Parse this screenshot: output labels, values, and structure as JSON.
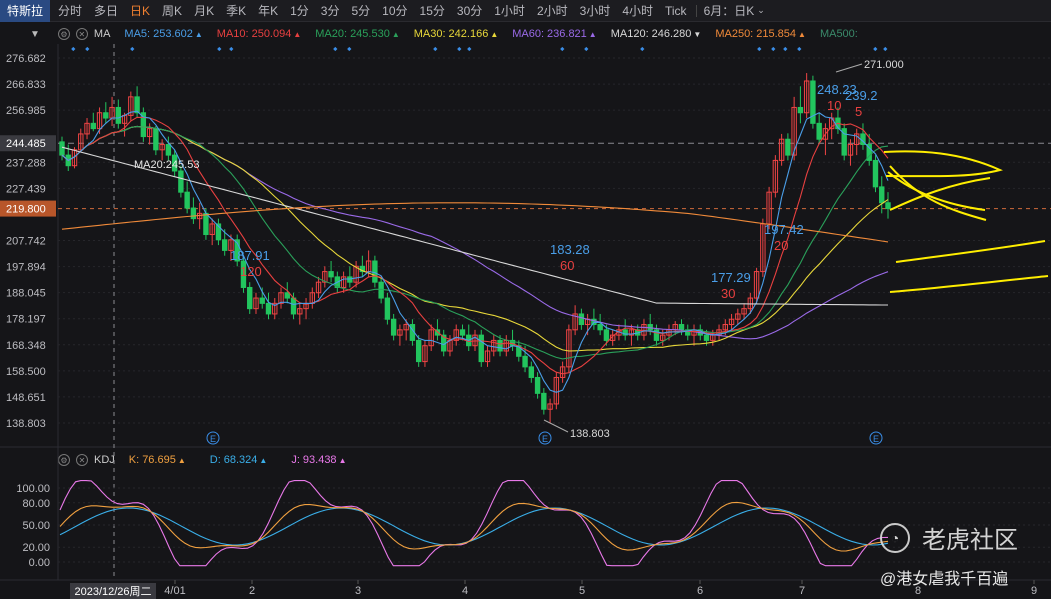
{
  "topbar": {
    "stock": "特斯拉",
    "tabs": [
      "分时",
      "多日",
      "日K",
      "周K",
      "月K",
      "季K",
      "年K",
      "1分",
      "3分",
      "5分",
      "10分",
      "15分",
      "30分",
      "1小时",
      "2小时",
      "3小时",
      "4小时",
      "Tick"
    ],
    "active_tab": "日K",
    "period_select": "6月：日K"
  },
  "ma_bar": {
    "label": "MA",
    "items": [
      {
        "name": "MA5:",
        "value": "253.602",
        "color": "#4a9ee8",
        "trend": "up"
      },
      {
        "name": "MA10:",
        "value": "250.094",
        "color": "#e84040",
        "trend": "up"
      },
      {
        "name": "MA20:",
        "value": "245.530",
        "color": "#2aa05a",
        "trend": "up"
      },
      {
        "name": "MA30:",
        "value": "242.166",
        "color": "#e8d83a",
        "trend": "up"
      },
      {
        "name": "MA60:",
        "value": "236.821",
        "color": "#9a6ae8",
        "trend": "up"
      },
      {
        "name": "MA120:",
        "value": "246.280",
        "color": "#d8d8d8",
        "trend": "down"
      },
      {
        "name": "MA250:",
        "value": "215.854",
        "color": "#f08a3a",
        "trend": "up"
      },
      {
        "name": "MA500:",
        "value": "",
        "color": "#3a8a6a",
        "trend": ""
      }
    ]
  },
  "kdj_bar": {
    "label": "KDJ",
    "items": [
      {
        "name": "K:",
        "value": "76.695",
        "color": "#f0a040",
        "trend": "up"
      },
      {
        "name": "D:",
        "value": "68.324",
        "color": "#3aaee8",
        "trend": "up"
      },
      {
        "name": "J:",
        "value": "93.438",
        "color": "#e878e8",
        "trend": "up"
      }
    ]
  },
  "price_axis": {
    "ticks": [
      "276.682",
      "266.833",
      "256.985",
      "237.288",
      "227.439",
      "207.742",
      "197.894",
      "188.045",
      "178.197",
      "168.348",
      "158.500",
      "148.651",
      "138.803"
    ],
    "crosshair_label": "244.485",
    "last_price_label": "219.800"
  },
  "kdj_axis": {
    "ticks": [
      "100.00",
      "80.00",
      "50.00",
      "20.00",
      "0.00"
    ]
  },
  "x_axis": {
    "labels": [
      "4/01",
      "2",
      "3",
      "4",
      "5",
      "6",
      "7",
      "8",
      "9"
    ],
    "cursor_label": "2023/12/26周二"
  },
  "annotations": {
    "cursor_ma": "MA20:245.53",
    "high_label": "271.000",
    "low_label": "138.803",
    "peaks": [
      {
        "price": "187.91",
        "count": "120"
      },
      {
        "price": "183.28",
        "count": "60"
      },
      {
        "price": "177.29",
        "count": "30"
      },
      {
        "price": "197.42",
        "count": "20"
      },
      {
        "price": "248.23",
        "count": "10"
      },
      {
        "price": "239.2",
        "count": "5"
      }
    ],
    "earnings_marker": "E"
  },
  "watermark": {
    "brand": "老虎社区",
    "credit": "@港女虐我千百遍"
  },
  "colors": {
    "up": "#ef4444",
    "down": "#22c55e",
    "ma5": "#4a9ee8",
    "ma10": "#e84040",
    "ma20": "#2aa05a",
    "ma30": "#e8d83a",
    "ma60": "#9a6ae8",
    "ma120": "#d8d8d8",
    "ma250": "#f08a3a",
    "drawing": "#ffee00"
  },
  "chart_data": {
    "type": "candlestick",
    "ylim": [
      138.803,
      276.682
    ],
    "candles": [
      [
        245,
        247,
        238,
        240
      ],
      [
        240,
        244,
        234,
        236
      ],
      [
        236,
        243,
        235,
        242
      ],
      [
        242,
        250,
        241,
        248
      ],
      [
        248,
        254,
        246,
        252
      ],
      [
        252,
        256,
        249,
        250
      ],
      [
        250,
        258,
        248,
        256
      ],
      [
        256,
        260,
        252,
        254
      ],
      [
        254,
        262,
        251,
        258
      ],
      [
        258,
        261,
        250,
        252
      ],
      [
        252,
        256,
        247,
        255
      ],
      [
        255,
        264,
        253,
        262
      ],
      [
        262,
        266,
        254,
        256
      ],
      [
        256,
        258,
        245,
        247
      ],
      [
        247,
        252,
        244,
        250
      ],
      [
        250,
        251,
        240,
        242
      ],
      [
        242,
        246,
        238,
        244
      ],
      [
        244,
        247,
        238,
        240
      ],
      [
        240,
        242,
        232,
        234
      ],
      [
        234,
        236,
        224,
        226
      ],
      [
        226,
        230,
        218,
        220
      ],
      [
        220,
        224,
        214,
        216
      ],
      [
        216,
        222,
        212,
        218
      ],
      [
        218,
        220,
        208,
        210
      ],
      [
        210,
        216,
        206,
        214
      ],
      [
        214,
        216,
        206,
        208
      ],
      [
        208,
        212,
        202,
        204
      ],
      [
        204,
        210,
        200,
        208
      ],
      [
        208,
        210,
        198,
        200
      ],
      [
        200,
        202,
        188,
        190
      ],
      [
        190,
        192,
        180,
        182
      ],
      [
        182,
        188,
        180,
        186
      ],
      [
        186,
        190,
        182,
        184
      ],
      [
        184,
        188,
        178,
        180
      ],
      [
        180,
        186,
        178,
        184
      ],
      [
        184,
        190,
        182,
        188
      ],
      [
        188,
        192,
        184,
        186
      ],
      [
        186,
        188,
        178,
        180
      ],
      [
        180,
        184,
        176,
        182
      ],
      [
        182,
        186,
        178,
        184
      ],
      [
        184,
        190,
        182,
        188
      ],
      [
        188,
        194,
        186,
        192
      ],
      [
        192,
        198,
        190,
        196
      ],
      [
        196,
        200,
        192,
        194
      ],
      [
        194,
        196,
        188,
        190
      ],
      [
        190,
        196,
        188,
        194
      ],
      [
        194,
        198,
        190,
        192
      ],
      [
        192,
        200,
        190,
        198
      ],
      [
        198,
        202,
        194,
        196
      ],
      [
        196,
        204,
        194,
        200
      ],
      [
        200,
        202,
        190,
        192
      ],
      [
        192,
        194,
        184,
        186
      ],
      [
        186,
        188,
        176,
        178
      ],
      [
        178,
        180,
        170,
        172
      ],
      [
        172,
        176,
        168,
        174
      ],
      [
        174,
        178,
        170,
        176
      ],
      [
        176,
        178,
        168,
        170
      ],
      [
        170,
        172,
        160,
        162
      ],
      [
        162,
        170,
        160,
        168
      ],
      [
        168,
        176,
        166,
        174
      ],
      [
        174,
        178,
        170,
        172
      ],
      [
        172,
        174,
        164,
        166
      ],
      [
        166,
        172,
        164,
        170
      ],
      [
        170,
        176,
        168,
        174
      ],
      [
        174,
        176,
        170,
        172
      ],
      [
        172,
        176,
        166,
        168
      ],
      [
        168,
        174,
        166,
        172
      ],
      [
        172,
        174,
        160,
        162
      ],
      [
        162,
        168,
        160,
        166
      ],
      [
        166,
        172,
        164,
        170
      ],
      [
        170,
        172,
        164,
        166
      ],
      [
        166,
        172,
        164,
        170
      ],
      [
        170,
        174,
        166,
        168
      ],
      [
        168,
        170,
        162,
        164
      ],
      [
        164,
        168,
        158,
        160
      ],
      [
        160,
        162,
        154,
        156
      ],
      [
        156,
        158,
        148,
        150
      ],
      [
        150,
        152,
        142,
        144
      ],
      [
        144,
        148,
        138.803,
        146
      ],
      [
        146,
        158,
        144,
        156
      ],
      [
        156,
        162,
        154,
        160
      ],
      [
        160,
        176,
        158,
        174
      ],
      [
        174,
        183.28,
        172,
        180
      ],
      [
        180,
        182,
        174,
        176
      ],
      [
        176,
        180,
        172,
        178
      ],
      [
        178,
        182,
        174,
        176
      ],
      [
        176,
        180,
        172,
        174
      ],
      [
        174,
        176,
        168,
        170
      ],
      [
        170,
        174,
        168,
        172
      ],
      [
        172,
        176,
        170,
        174
      ],
      [
        174,
        178,
        170,
        172
      ],
      [
        172,
        176,
        168,
        174
      ],
      [
        174,
        176,
        170,
        172
      ],
      [
        172,
        178,
        170,
        176
      ],
      [
        176,
        180,
        172,
        174
      ],
      [
        174,
        176,
        168,
        170
      ],
      [
        170,
        174,
        168,
        172
      ],
      [
        172,
        176,
        170,
        174
      ],
      [
        174,
        177.29,
        172,
        176
      ],
      [
        176,
        178,
        172,
        174
      ],
      [
        174,
        176,
        170,
        172
      ],
      [
        172,
        176,
        168,
        174
      ],
      [
        174,
        176,
        170,
        172
      ],
      [
        172,
        174,
        168,
        170
      ],
      [
        170,
        174,
        168,
        172
      ],
      [
        172,
        176,
        170,
        174
      ],
      [
        174,
        178,
        172,
        176
      ],
      [
        176,
        180,
        174,
        178
      ],
      [
        178,
        182,
        176,
        180
      ],
      [
        180,
        184,
        178,
        182
      ],
      [
        182,
        188,
        180,
        186
      ],
      [
        186,
        197.42,
        184,
        196
      ],
      [
        196,
        216,
        194,
        214
      ],
      [
        214,
        228,
        212,
        226
      ],
      [
        226,
        240,
        224,
        238
      ],
      [
        238,
        248,
        236,
        246
      ],
      [
        246,
        248.23,
        238,
        240
      ],
      [
        240,
        262,
        238,
        258
      ],
      [
        258,
        266,
        252,
        256
      ],
      [
        256,
        271,
        254,
        268
      ],
      [
        268,
        270,
        250,
        252
      ],
      [
        252,
        256,
        244,
        246
      ],
      [
        246,
        252,
        240,
        250
      ],
      [
        250,
        256,
        246,
        254
      ],
      [
        254,
        258,
        248,
        250
      ],
      [
        250,
        252,
        238,
        240
      ],
      [
        240,
        246,
        236,
        244
      ],
      [
        244,
        250,
        240,
        248
      ],
      [
        248,
        252,
        242,
        244
      ],
      [
        244,
        248,
        236,
        238
      ],
      [
        238,
        240,
        226,
        228
      ],
      [
        228,
        232,
        218,
        222
      ],
      [
        222,
        226,
        216,
        219.8
      ]
    ],
    "high": "271.000",
    "low": "138.803",
    "kdj": {
      "k": "76.695",
      "d": "68.324",
      "j": "93.438"
    }
  }
}
